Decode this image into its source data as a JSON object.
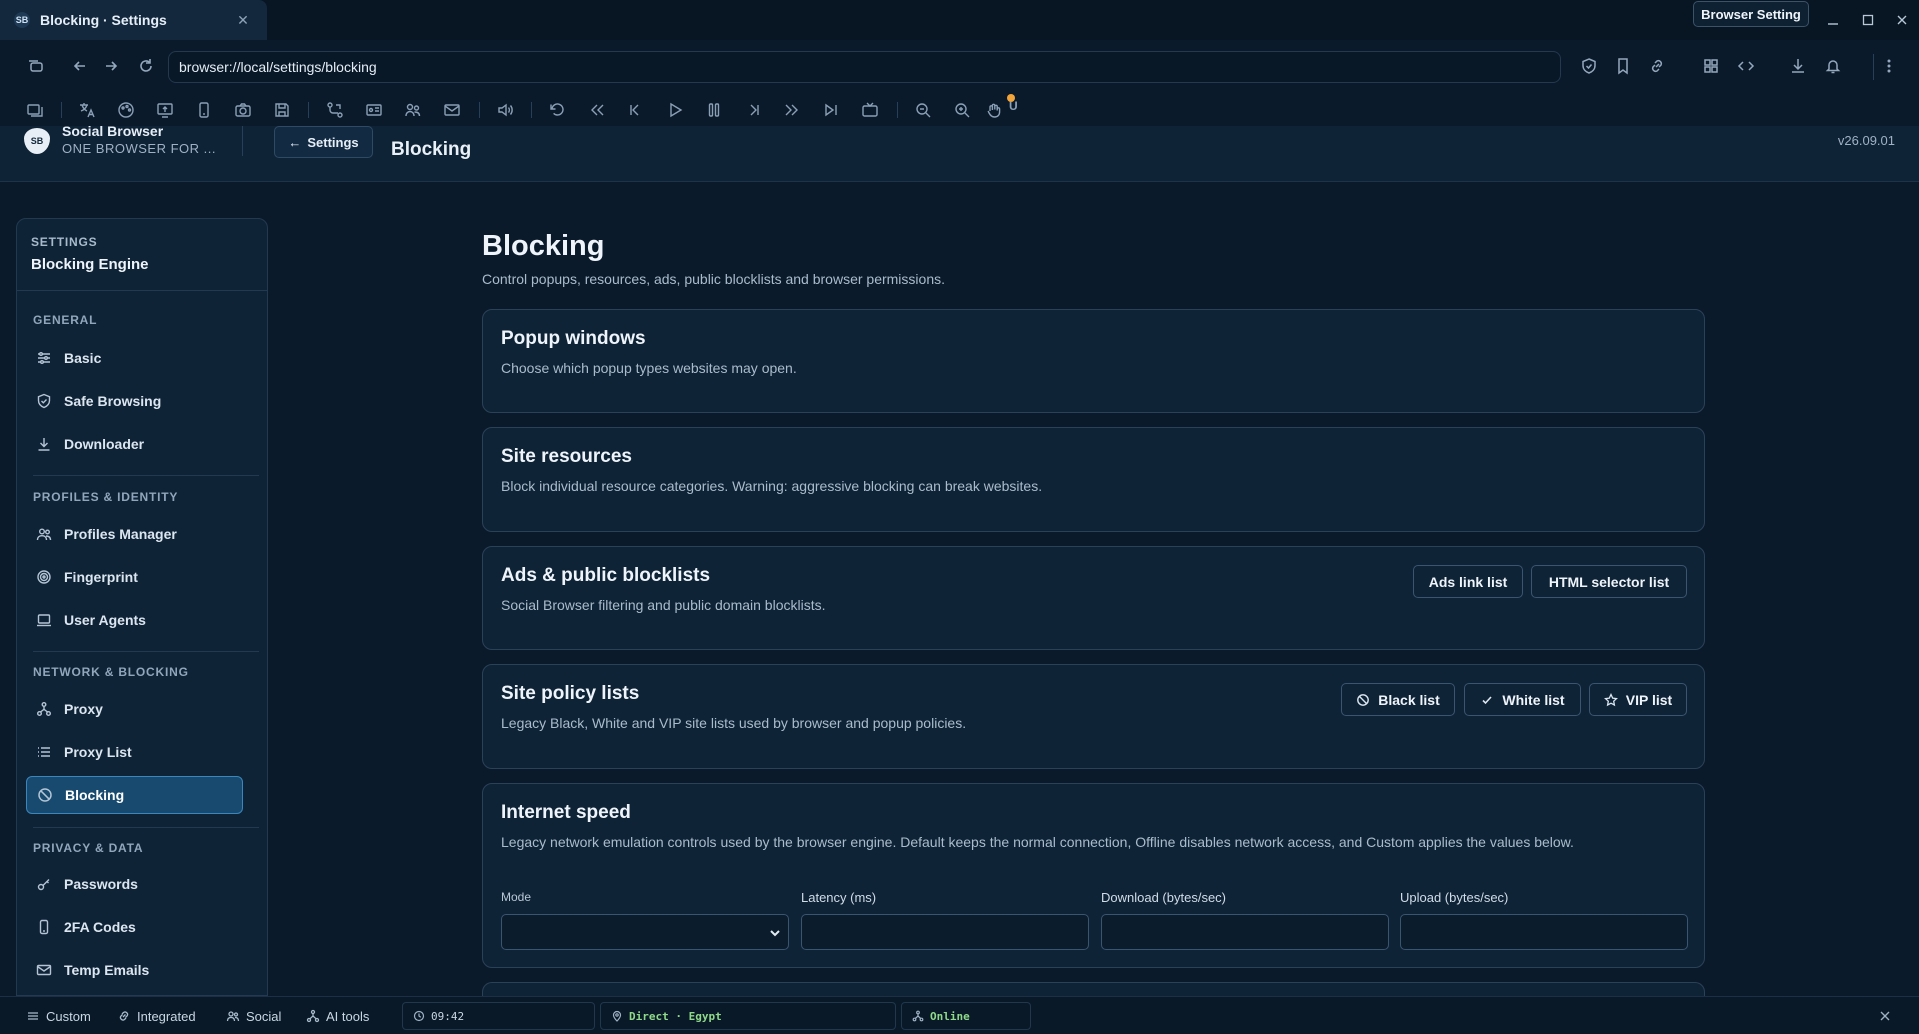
{
  "window": {
    "tab_title": "Blocking · Settings",
    "favicon_text": "SB",
    "browser_setting_label": "Browser Setting"
  },
  "address": {
    "url": "browser://local/settings/blocking"
  },
  "toolbar": {
    "badge_letter": "U"
  },
  "header": {
    "logo_text": "SB",
    "brand_name": "Social Browser",
    "brand_sub": "ONE BROWSER FOR ...",
    "back_label": "Settings",
    "title": "Blocking",
    "version": "v26.09.01"
  },
  "sidebar": {
    "head_small": "SETTINGS",
    "head_big": "Blocking Engine",
    "sections": [
      {
        "label": "GENERAL",
        "items": [
          {
            "label": "Basic",
            "icon": "sliders-icon"
          },
          {
            "label": "Safe Browsing",
            "icon": "shield-icon"
          },
          {
            "label": "Downloader",
            "icon": "download-icon"
          }
        ]
      },
      {
        "label": "PROFILES & IDENTITY",
        "items": [
          {
            "label": "Profiles Manager",
            "icon": "users-icon"
          },
          {
            "label": "Fingerprint",
            "icon": "fingerprint-icon"
          },
          {
            "label": "User Agents",
            "icon": "laptop-icon"
          }
        ]
      },
      {
        "label": "NETWORK & BLOCKING",
        "items": [
          {
            "label": "Proxy",
            "icon": "network-icon"
          },
          {
            "label": "Proxy List",
            "icon": "list-icon"
          },
          {
            "label": "Blocking",
            "icon": "ban-icon",
            "active": true
          }
        ]
      },
      {
        "label": "PRIVACY & DATA",
        "items": [
          {
            "label": "Passwords",
            "icon": "key-icon"
          },
          {
            "label": "2FA Codes",
            "icon": "phone-icon"
          },
          {
            "label": "Temp Emails",
            "icon": "mail-icon"
          }
        ]
      }
    ]
  },
  "main": {
    "title": "Blocking",
    "description": "Control popups, resources, ads, public blocklists and browser permissions.",
    "cards": [
      {
        "title": "Popup windows",
        "desc": "Choose which popup types websites may open."
      },
      {
        "title": "Site resources",
        "desc": "Block individual resource categories. Warning: aggressive blocking can break websites."
      },
      {
        "title": "Ads & public blocklists",
        "desc": "Social Browser filtering and public domain blocklists.",
        "buttons": [
          "Ads link list",
          "HTML selector list"
        ]
      },
      {
        "title": "Site policy lists",
        "desc": "Legacy Black, White and VIP site lists used by browser and popup policies.",
        "buttons": [
          "Black list",
          "White list",
          "VIP list"
        ]
      },
      {
        "title": "Internet speed",
        "desc": "Legacy network emulation controls used by the browser engine. Default keeps the normal connection, Offline disables network access, and Custom applies the values below.",
        "fields": [
          {
            "label": "Mode",
            "value": ""
          },
          {
            "label": "Latency (ms)",
            "value": ""
          },
          {
            "label": "Download (bytes/sec)",
            "value": ""
          },
          {
            "label": "Upload (bytes/sec)",
            "value": ""
          }
        ]
      }
    ]
  },
  "statusbar": {
    "items": [
      "Custom",
      "Integrated",
      "Social",
      "AI tools"
    ],
    "time": "09:42",
    "location": "Direct · Egypt",
    "status": "Online"
  },
  "colors": {
    "background": "#0b1a2a",
    "panel": "#0f2336",
    "accent_active": "#174a6e",
    "online": "#8fd98a"
  }
}
